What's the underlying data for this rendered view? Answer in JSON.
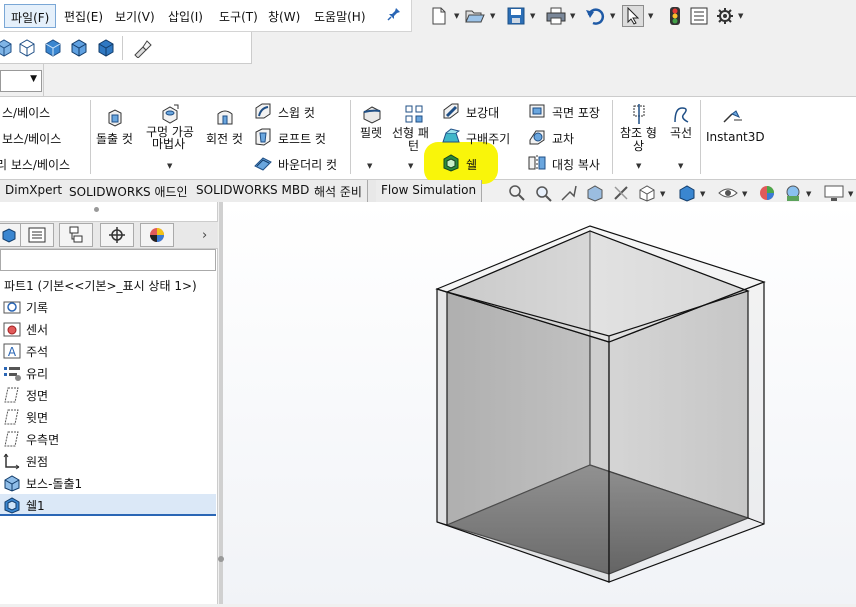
{
  "menubar": {
    "items": [
      "파일(F)",
      "편집(E)",
      "보기(V)",
      "삽입(I)",
      "도구(T)",
      "창(W)",
      "도움말(H)"
    ]
  },
  "icons": {
    "pin": "pin-icon",
    "new": "new-doc-icon",
    "open": "open-icon",
    "save": "save-icon",
    "print": "print-icon",
    "undo": "undo-icon",
    "select": "select-cursor-icon",
    "rebuild": "traffic-light-icon",
    "file_props": "file-properties-icon",
    "options": "gear-icon"
  },
  "command_manager": {
    "left_partial": [
      "스/베이스",
      "보스/베이스",
      "리 보스/베이스"
    ],
    "extruded_cut": "돌출 컷",
    "hole_wizard": [
      "구멍 가공",
      "마법사"
    ],
    "revolved_cut": "회전 컷",
    "swept_cut": "스윕 컷",
    "lofted_cut": "로프트 컷",
    "boundary_cut": "바운더리 컷",
    "fillet": "필렛",
    "linear_pattern": [
      "선형 패",
      "턴"
    ],
    "rib": "보강대",
    "draft": "구배주기",
    "shell": "쉘",
    "wrap": "곡면 포장",
    "intersect": "교차",
    "mirror": "대칭 복사",
    "ref_geometry": [
      "참조 형",
      "상"
    ],
    "curves": "곡선",
    "instant3d": "Instant3D"
  },
  "tabs": [
    "DimXpert",
    "SOLIDWORKS 애드인",
    "SOLIDWORKS MBD",
    "해석 준비",
    "Flow Simulation"
  ],
  "tree": {
    "root": "파트1  (기본<<기본>_표시 상태 1>)",
    "items": [
      "기록",
      "센서",
      "주석",
      "유리",
      "정면",
      "윗면",
      "우측면",
      "원점",
      "보스-돌출1",
      "쉘1"
    ]
  },
  "colors": {
    "highlight": "#f9f50a",
    "accent": "#2a66b5"
  }
}
